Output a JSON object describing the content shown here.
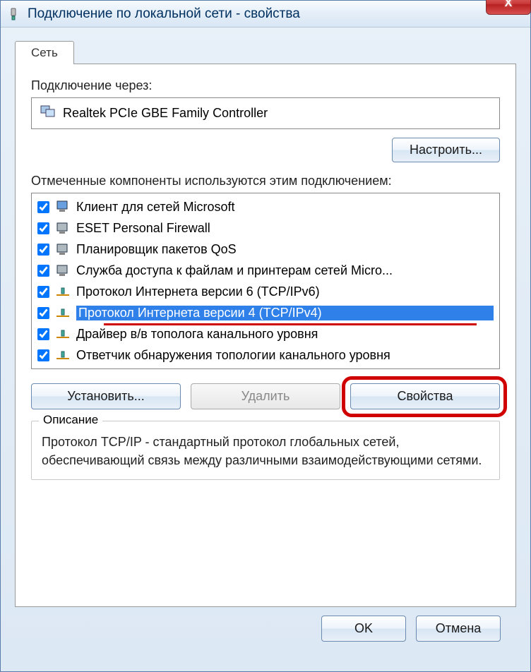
{
  "window": {
    "title": "Подключение по локальной сети - свойства"
  },
  "tab": {
    "label": "Сеть"
  },
  "connect_via_label": "Подключение через:",
  "adapter_name": "Realtek PCIe GBE Family Controller",
  "configure_btn": "Настроить...",
  "components_label": "Отмеченные компоненты используются этим подключением:",
  "components": [
    {
      "label": "Клиент для сетей Microsoft",
      "icon": "client"
    },
    {
      "label": "ESET Personal Firewall",
      "icon": "firewall"
    },
    {
      "label": "Планировщик пакетов QoS",
      "icon": "qos"
    },
    {
      "label": "Служба доступа к файлам и принтерам сетей Micro...",
      "icon": "share"
    },
    {
      "label": "Протокол Интернета версии 6 (TCP/IPv6)",
      "icon": "proto"
    },
    {
      "label": "Протокол Интернета версии 4 (TCP/IPv4)",
      "icon": "proto",
      "selected": true,
      "underline": true
    },
    {
      "label": "Драйвер в/в тополога канального уровня",
      "icon": "proto"
    },
    {
      "label": "Ответчик обнаружения топологии канального уровня",
      "icon": "proto"
    }
  ],
  "install_btn": "Установить...",
  "remove_btn": "Удалить",
  "properties_btn": "Свойства",
  "description": {
    "title": "Описание",
    "text": "Протокол TCP/IP - стандартный протокол глобальных сетей, обеспечивающий связь между различными взаимодействующими сетями."
  },
  "ok_btn": "OK",
  "cancel_btn": "Отмена"
}
